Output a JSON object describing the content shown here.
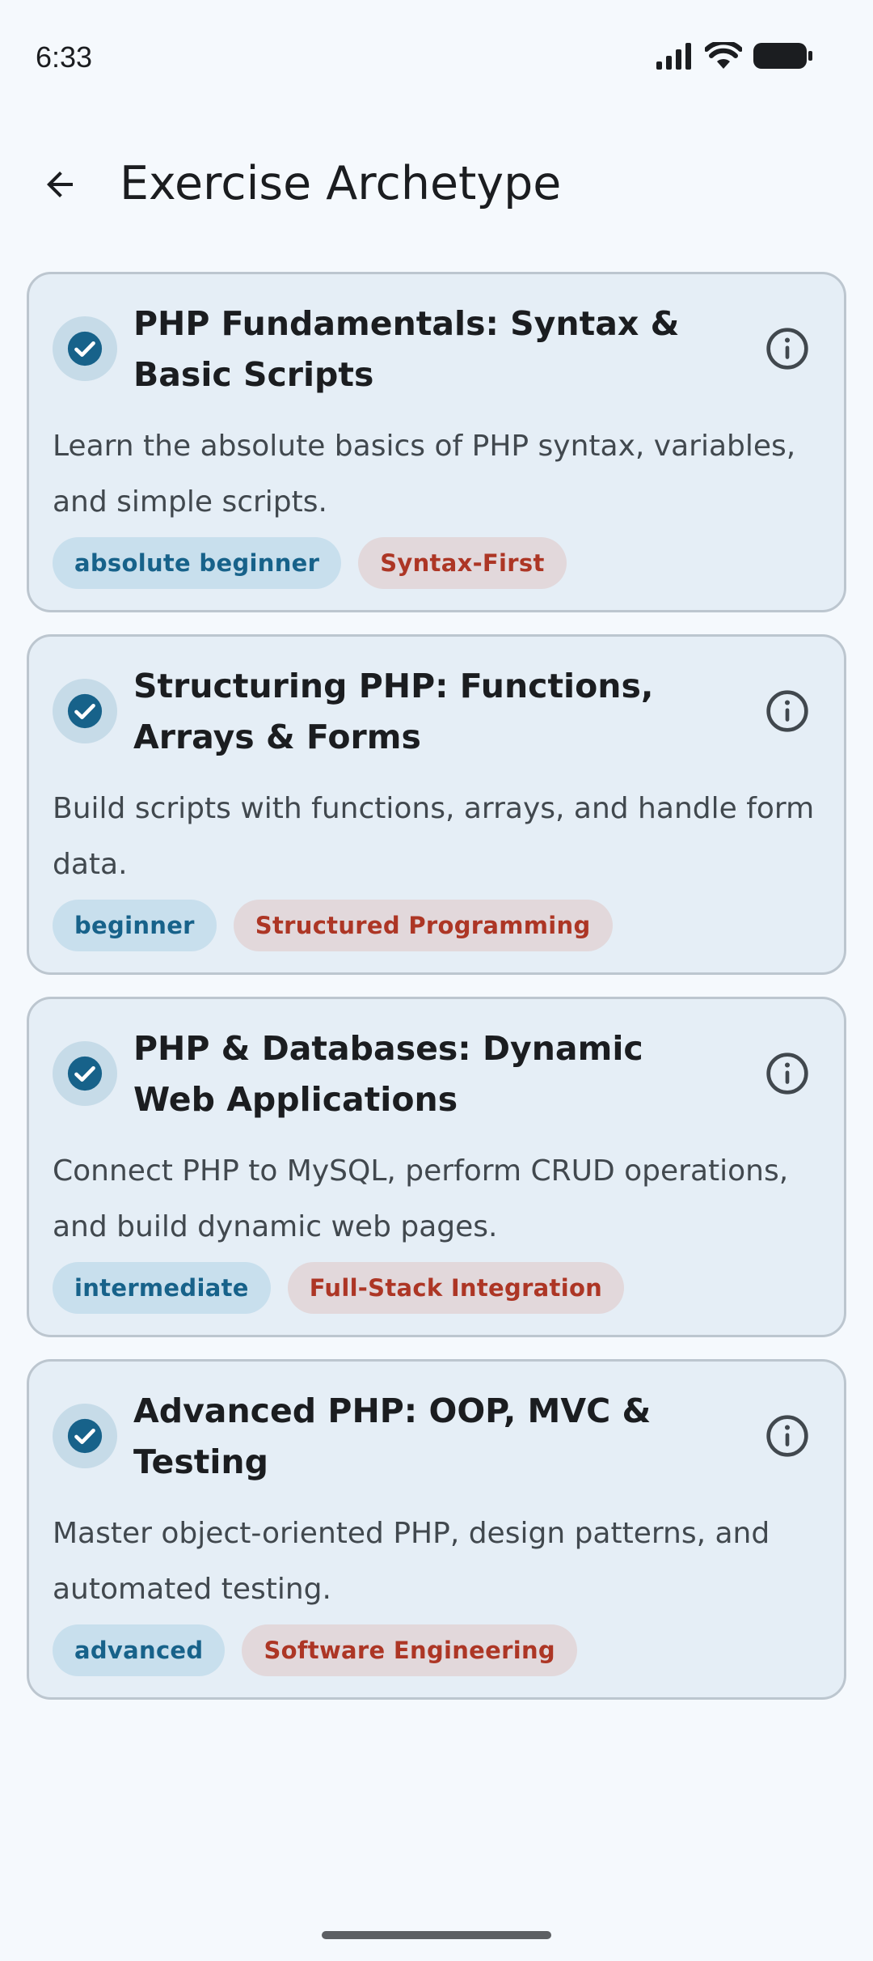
{
  "status_bar": {
    "time": "6:33"
  },
  "header": {
    "title": "Exercise Archetype",
    "back_icon": "arrow-back-icon"
  },
  "colors": {
    "background": "#f5f9fd",
    "card_background": "#e5eef6",
    "check_accent": "#17628a",
    "level_tag_text": "#17628a",
    "style_tag_text": "#ad3625"
  },
  "archetypes": [
    {
      "title": "PHP Fundamentals: Syntax & Basic Scripts",
      "description": "Learn the absolute basics of PHP syntax, variables, and simple scripts.",
      "level": "absolute beginner",
      "style": "Syntax-First",
      "selected": true
    },
    {
      "title": "Structuring PHP: Functions, Arrays & Forms",
      "description": "Build scripts with functions, arrays, and handle form data.",
      "level": "beginner",
      "style": "Structured Programming",
      "selected": true
    },
    {
      "title": "PHP & Databases: Dynamic Web Applications",
      "description": "Connect PHP to MySQL, perform CRUD operations, and build dynamic web pages.",
      "level": "intermediate",
      "style": "Full-Stack Integration",
      "selected": true
    },
    {
      "title": "Advanced PHP: OOP, MVC & Testing",
      "description": "Master object-oriented PHP, design patterns, and automated testing.",
      "level": "advanced",
      "style": "Software Engineering",
      "selected": true
    }
  ]
}
